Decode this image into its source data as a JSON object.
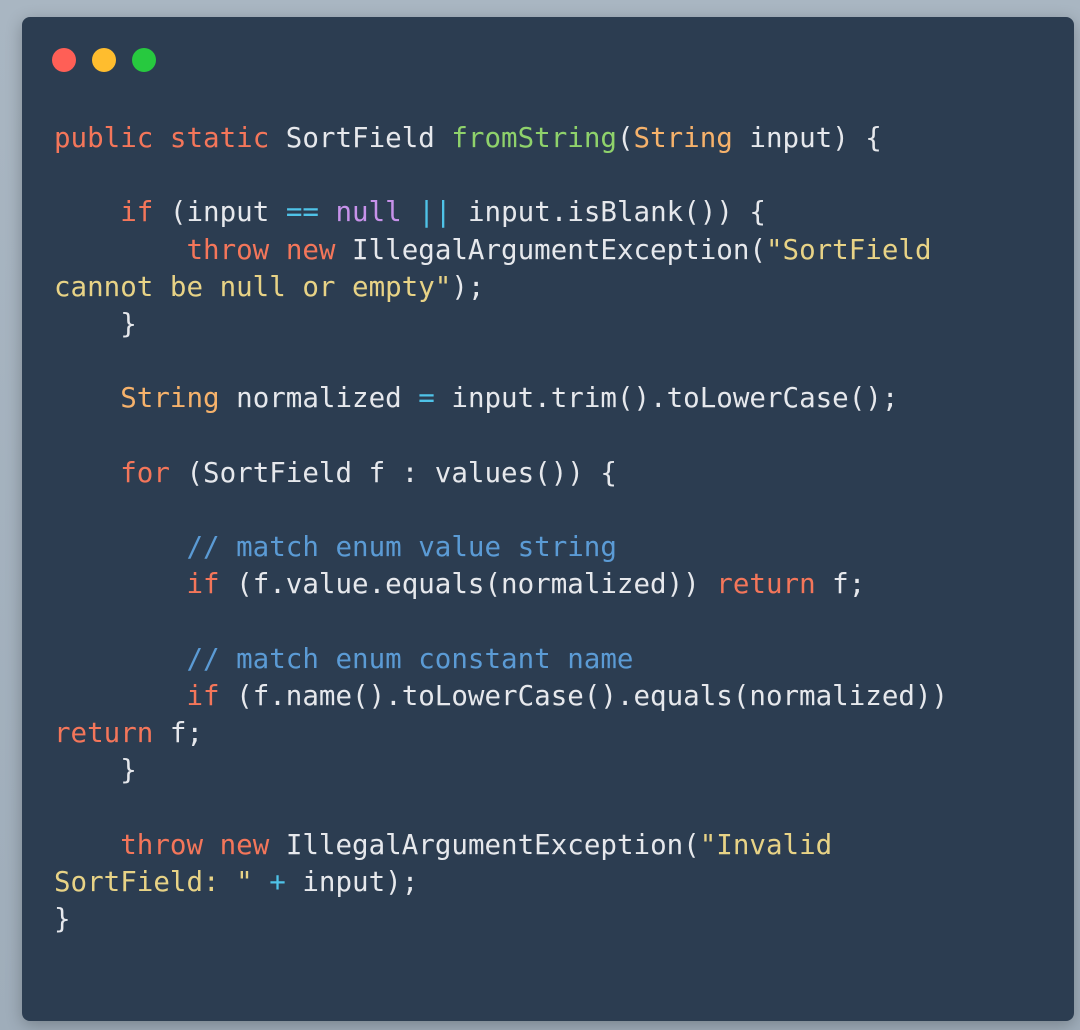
{
  "window": {
    "controls": {
      "close": "close-button",
      "minimize": "minimize-button",
      "maximize": "maximize-button"
    },
    "colors": {
      "background": "#2c3d51",
      "keyword": "#f4765a",
      "function": "#8fd26b",
      "type": "#f6b26b",
      "operator": "#4fc3e8",
      "null": "#c792ea",
      "string": "#e8d386",
      "comment": "#5b9bd5",
      "text": "#e6e8ec"
    }
  },
  "code": {
    "lines": [
      [
        [
          "kw",
          "public"
        ],
        [
          "pl",
          " "
        ],
        [
          "kw",
          "static"
        ],
        [
          "pl",
          " SortField "
        ],
        [
          "fn",
          "fromString"
        ],
        [
          "pl",
          "("
        ],
        [
          "ty",
          "String"
        ],
        [
          "pl",
          " input) {"
        ]
      ],
      [],
      [
        [
          "pl",
          "    "
        ],
        [
          "kw",
          "if"
        ],
        [
          "pl",
          " (input "
        ],
        [
          "op",
          "=="
        ],
        [
          "pl",
          " "
        ],
        [
          "nl",
          "null"
        ],
        [
          "pl",
          " "
        ],
        [
          "op",
          "||"
        ],
        [
          "pl",
          " input.isBlank()) {"
        ]
      ],
      [
        [
          "pl",
          "        "
        ],
        [
          "kw",
          "throw"
        ],
        [
          "pl",
          " "
        ],
        [
          "kw",
          "new"
        ],
        [
          "pl",
          " IllegalArgumentException("
        ],
        [
          "str",
          "\"SortField"
        ]
      ],
      [
        [
          "str",
          "cannot be null or empty\""
        ],
        [
          "pl",
          ");"
        ]
      ],
      [
        [
          "pl",
          "    }"
        ]
      ],
      [],
      [
        [
          "pl",
          "    "
        ],
        [
          "ty",
          "String"
        ],
        [
          "pl",
          " normalized "
        ],
        [
          "op",
          "="
        ],
        [
          "pl",
          " input.trim().toLowerCase();"
        ]
      ],
      [],
      [
        [
          "pl",
          "    "
        ],
        [
          "kw",
          "for"
        ],
        [
          "pl",
          " (SortField f : values()) {"
        ]
      ],
      [],
      [
        [
          "pl",
          "        "
        ],
        [
          "cm",
          "// match enum value string"
        ]
      ],
      [
        [
          "pl",
          "        "
        ],
        [
          "kw",
          "if"
        ],
        [
          "pl",
          " (f.value.equals(normalized)) "
        ],
        [
          "kw",
          "return"
        ],
        [
          "pl",
          " f;"
        ]
      ],
      [],
      [
        [
          "pl",
          "        "
        ],
        [
          "cm",
          "// match enum constant name"
        ]
      ],
      [
        [
          "pl",
          "        "
        ],
        [
          "kw",
          "if"
        ],
        [
          "pl",
          " (f.name().toLowerCase().equals(normalized))"
        ]
      ],
      [
        [
          "kw",
          "return"
        ],
        [
          "pl",
          " f;"
        ]
      ],
      [
        [
          "pl",
          "    }"
        ]
      ],
      [],
      [
        [
          "pl",
          "    "
        ],
        [
          "kw",
          "throw"
        ],
        [
          "pl",
          " "
        ],
        [
          "kw",
          "new"
        ],
        [
          "pl",
          " IllegalArgumentException("
        ],
        [
          "str",
          "\"Invalid"
        ]
      ],
      [
        [
          "str",
          "SortField: \""
        ],
        [
          "pl",
          " "
        ],
        [
          "op",
          "+"
        ],
        [
          "pl",
          " input);"
        ]
      ],
      [
        [
          "pl",
          "}"
        ]
      ]
    ]
  }
}
